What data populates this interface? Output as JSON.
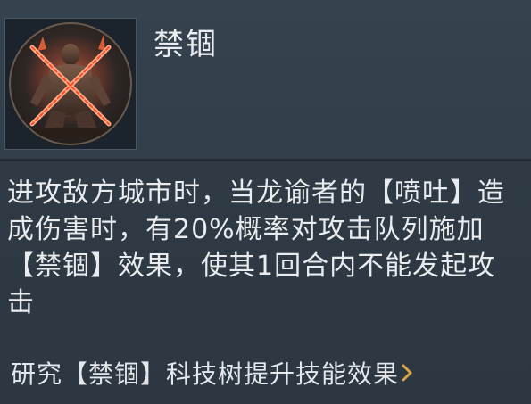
{
  "skill": {
    "title": "禁锢",
    "icon": "shackled-warrior-icon",
    "description": "进攻敌方城市时，当龙谕者的【喷吐】造成伤害时，有20%概率对攻击队列施加【禁锢】效果，使其1回合内不能发起攻击"
  },
  "research": {
    "label": "研究【禁锢】科技树提升技能效果",
    "icon": "chevron-right-icon"
  },
  "colors": {
    "background": "#2f3a45",
    "text": "#e8ecef",
    "accent": "#d9a542",
    "glow": "#ff5a3c"
  }
}
